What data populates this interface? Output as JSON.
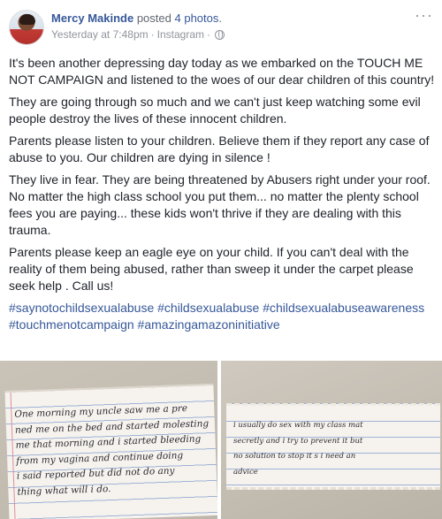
{
  "post": {
    "author": "Mercy Makinde",
    "action_prefix": "posted",
    "action_count": "4 photos",
    "action_suffix": ".",
    "timestamp": "Yesterday at 7:48pm",
    "separator": "·",
    "source": "Instagram",
    "privacy_icon": "globe-icon",
    "more_icon": "ellipsis-icon"
  },
  "content": {
    "paragraphs": [
      "It's been another depressing day today as we embarked on the TOUCH ME NOT CAMPAIGN and listened to the woes of our dear children of this country!",
      "They are going through so much and we can't just keep watching some evil people destroy the lives of these innocent children.",
      "Parents please listen to your children. Believe them if they report any case of abuse to you. Our children are dying in silence !",
      "They live in fear. They are being threatened by Abusers right under your roof. No matter the high class school you put them... no matter the plenty school fees you are paying... these kids won't thrive if they are dealing with this trauma.",
      "Parents please keep an eagle eye on your child. If you can't deal with the reality of them being abused, rather than sweep it under the carpet please seek help . Call us!"
    ],
    "hashtags": [
      "#saynotochildsexualabuse",
      "#childsexualabuse",
      "#childsexualabuseawareness",
      "#touchmenotcampaign",
      "#amazingamazoninitiative"
    ]
  },
  "photos": {
    "photo_1_lines": [
      "One morning my uncle saw me a pre",
      "ned me on the bed and started molesting",
      "me that morning and i started bleeding",
      "from my vagina and continue doing",
      "i said reported but did not do any",
      "thing what will i do."
    ],
    "photo_2_lines": [
      "i usually do sex with my class mat",
      "secretly and i try to prevent it but",
      "no solution to stop it s i need an",
      "advice"
    ]
  },
  "colors": {
    "link": "#365899",
    "text": "#1d2129",
    "meta": "#90949c"
  }
}
